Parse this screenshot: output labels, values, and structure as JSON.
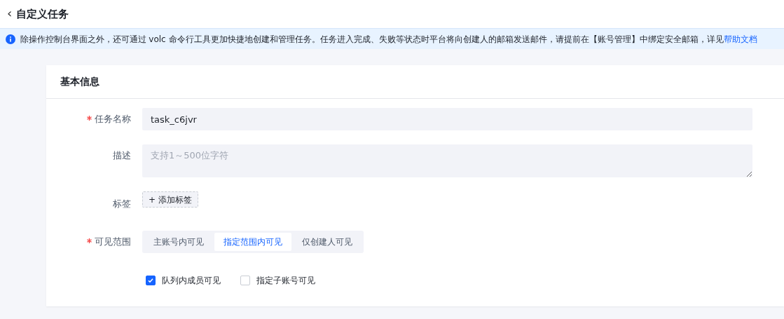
{
  "header": {
    "back": "‹",
    "title": "自定义任务"
  },
  "notice": {
    "text": "除操作控制台界面之外，还可通过 volc 命令行工具更加快捷地创建和管理任务。任务进入完成、失败等状态时平台将向创建人的邮箱发送邮件，请提前在【账号管理】中绑定安全邮箱，详见",
    "link": "帮助文档"
  },
  "section": {
    "title": "基本信息"
  },
  "form": [
    {
      "kind": "input",
      "label": "任务名称",
      "required": true,
      "value": "task_c6jvr"
    },
    {
      "kind": "textarea",
      "label": "描述",
      "required": false,
      "placeholder": "支持1～500位字符"
    },
    {
      "kind": "tag",
      "label": "标签",
      "required": false,
      "button": "+ 添加标签"
    },
    {
      "kind": "segmented",
      "label": "可见范围",
      "required": true,
      "options": [
        {
          "label": "主账号内可见",
          "selected": false
        },
        {
          "label": "指定范围内可见",
          "selected": true
        },
        {
          "label": "仅创建人可见",
          "selected": false
        }
      ]
    },
    {
      "kind": "checks",
      "options": [
        {
          "label": "队列内成员可见",
          "checked": true
        },
        {
          "label": "指定子账号可见",
          "checked": false
        }
      ]
    }
  ]
}
